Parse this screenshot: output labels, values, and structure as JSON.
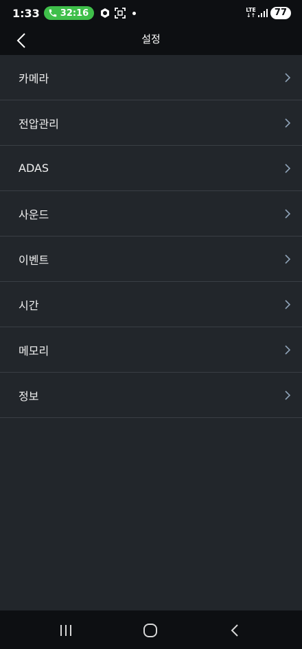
{
  "status_bar": {
    "time": "1:33",
    "call_duration": "32:16",
    "network": "LTE",
    "battery": "77"
  },
  "header": {
    "title": "설정",
    "back_icon": "chevron-left-icon"
  },
  "settings": {
    "items": [
      {
        "label": "카메라"
      },
      {
        "label": "전압관리"
      },
      {
        "label": "ADAS"
      },
      {
        "label": "사운드"
      },
      {
        "label": "이벤트"
      },
      {
        "label": "시간"
      },
      {
        "label": "메모리"
      },
      {
        "label": "정보"
      }
    ]
  },
  "nav_bar": {
    "icons": [
      "recent-apps-icon",
      "home-icon",
      "back-icon"
    ]
  },
  "colors": {
    "background": "#22262b",
    "bar": "#0d0f12",
    "divider": "#3a3f45",
    "chevron": "#8fa3b8",
    "call_pill": "#3fbf4a"
  }
}
